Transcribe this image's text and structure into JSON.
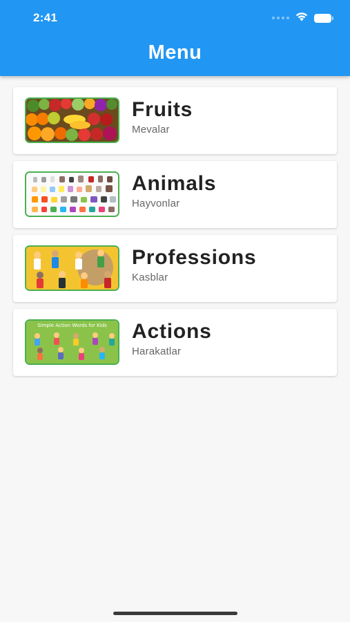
{
  "status_bar": {
    "time": "2:41"
  },
  "app_bar": {
    "title": "Menu",
    "color": "#2196f3"
  },
  "menu": [
    {
      "title": "Fruits",
      "subtitle": "Mevalar",
      "image": "fruits-thumbnail"
    },
    {
      "title": "Animals",
      "subtitle": "Hayvonlar",
      "image": "animals-thumbnail"
    },
    {
      "title": "Professions",
      "subtitle": "Kasblar",
      "image": "professions-thumbnail"
    },
    {
      "title": "Actions",
      "subtitle": "Harakatlar",
      "image": "actions-thumbnail",
      "image_caption": "Simple Action Words for Kids"
    }
  ],
  "colors": {
    "thumbnail_border": "#4caf50",
    "background": "#f7f7f7"
  }
}
